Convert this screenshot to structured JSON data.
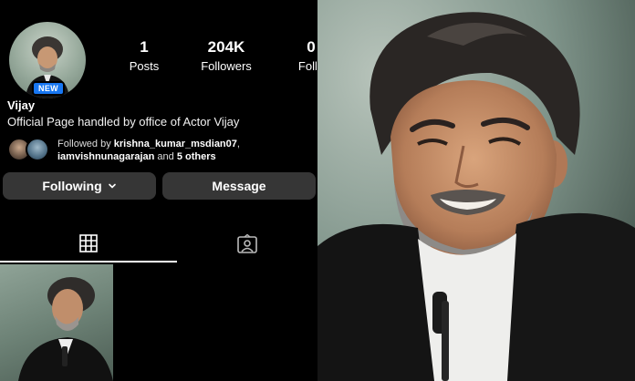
{
  "profile": {
    "badge": "NEW",
    "name": "Vijay",
    "bio": "Official Page handled by office of Actor Vijay",
    "stats": {
      "posts_count": "1",
      "posts_label": "Posts",
      "followers_count": "204K",
      "followers_label": "Followers",
      "following_count": "0",
      "following_label": "Follo"
    },
    "followed_by": {
      "prefix": "Followed by ",
      "user1": "krishna_kumar_msdian07",
      "separator": ",",
      "user2": "iamvishnunagarajan",
      "middle": " and ",
      "others": "5 others"
    }
  },
  "actions": {
    "following_label": "Following",
    "message_label": "Message"
  },
  "icons": {
    "chevron": "chevron-down-icon",
    "grid": "grid-icon",
    "tagged": "tagged-person-icon"
  },
  "colors": {
    "background": "#000000",
    "button": "#363636",
    "badge": "#1877f2"
  }
}
